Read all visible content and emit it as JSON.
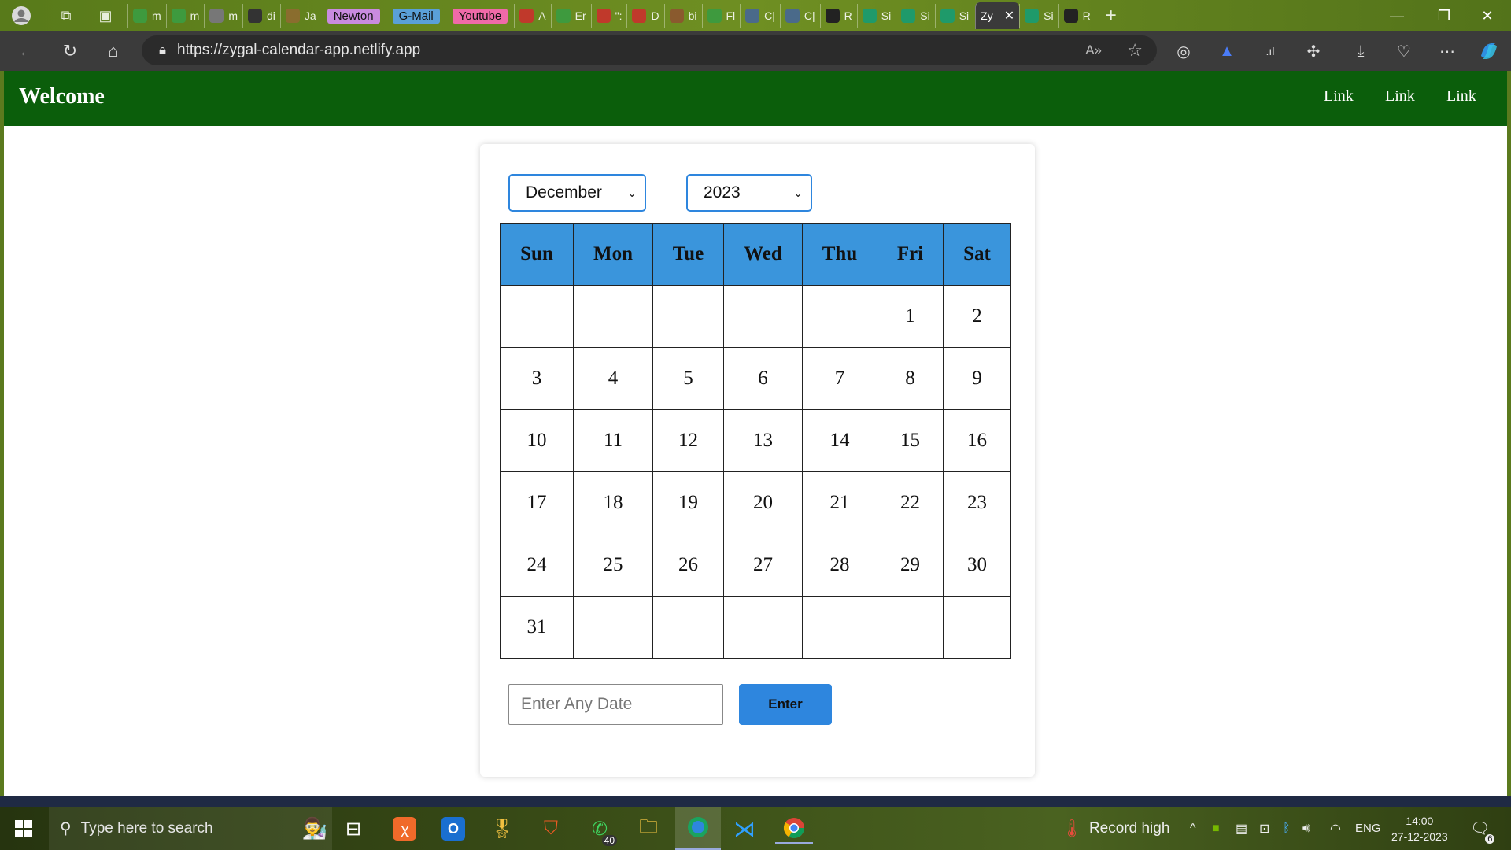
{
  "browser": {
    "tabs": [
      {
        "label": "m",
        "color": "#3e9a3e"
      },
      {
        "label": "m",
        "color": "#3e9a3e"
      },
      {
        "label": "m",
        "color": "#777777"
      },
      {
        "label": "di",
        "color": "#333333"
      },
      {
        "label": "Ja",
        "color": "#8a6d2e"
      },
      {
        "label": "A",
        "color": "#c0392b"
      },
      {
        "label": "Er",
        "color": "#3e9a3e"
      },
      {
        "label": "\":",
        "color": "#c0392b"
      },
      {
        "label": "D",
        "color": "#c0392b"
      },
      {
        "label": "bi",
        "color": "#8a5a2e"
      },
      {
        "label": "Fl",
        "color": "#3e9a3e"
      },
      {
        "label": "C|",
        "color": "#4a6a8a"
      },
      {
        "label": "C|",
        "color": "#4a6a8a"
      },
      {
        "label": "R",
        "color": "#222222"
      },
      {
        "label": "Si",
        "color": "#1f9a6a"
      },
      {
        "label": "Si",
        "color": "#1f9a6a"
      },
      {
        "label": "Si",
        "color": "#1f9a6a"
      }
    ],
    "bookmark_pills": [
      {
        "label": "Newton",
        "color": "#c98be0"
      },
      {
        "label": "G-Mail",
        "color": "#5aa0d8"
      },
      {
        "label": "Youtube",
        "color": "#f06aa8"
      }
    ],
    "active_tab": "Zy",
    "after_tabs": [
      {
        "label": "Si",
        "color": "#1f9a6a"
      },
      {
        "label": "R",
        "color": "#222222"
      }
    ],
    "url": "https://zygal-calendar-app.netlify.app"
  },
  "app": {
    "brand": "Welcome",
    "nav_links": [
      "Link",
      "Link",
      "Link"
    ],
    "month_select": "December",
    "year_select": "2023",
    "weekdays": [
      "Sun",
      "Mon",
      "Tue",
      "Wed",
      "Thu",
      "Fri",
      "Sat"
    ],
    "weeks": [
      [
        "",
        "",
        "",
        "",
        "",
        "1",
        "2"
      ],
      [
        "3",
        "4",
        "5",
        "6",
        "7",
        "8",
        "9"
      ],
      [
        "10",
        "11",
        "12",
        "13",
        "14",
        "15",
        "16"
      ],
      [
        "17",
        "18",
        "19",
        "20",
        "21",
        "22",
        "23"
      ],
      [
        "24",
        "25",
        "26",
        "27",
        "28",
        "29",
        "30"
      ],
      [
        "31",
        "",
        "",
        "",
        "",
        "",
        ""
      ]
    ],
    "date_input_placeholder": "Enter Any Date",
    "enter_button": "Enter"
  },
  "taskbar": {
    "search_placeholder": "Type here to search",
    "whatsapp_badge": "40",
    "weather_text": "Record high",
    "language": "ENG",
    "time": "14:00",
    "date": "27-12-2023",
    "notification_count": "6"
  }
}
